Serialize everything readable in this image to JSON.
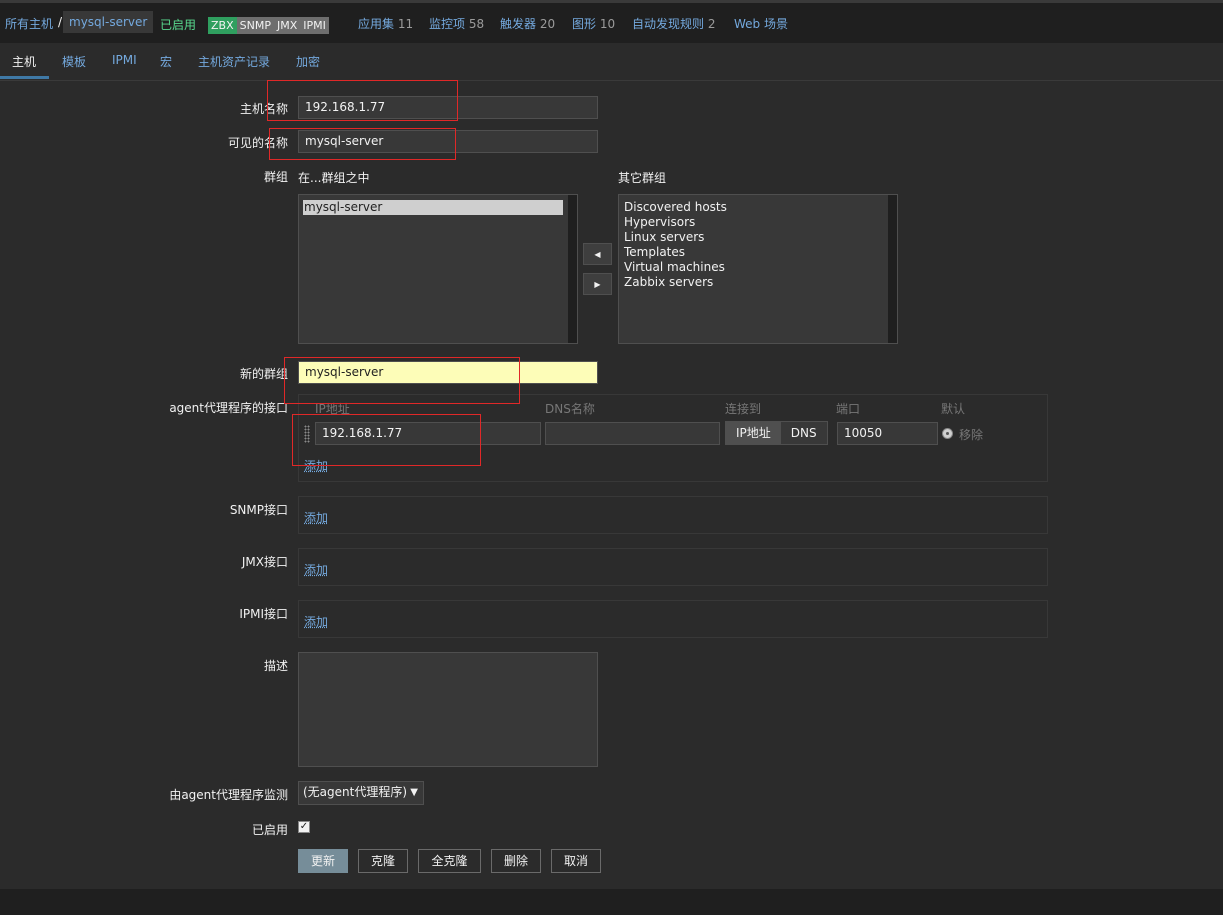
{
  "header": {
    "crumb_all_hosts": "所有主机",
    "crumb_sep": "/",
    "crumb_host": "mysql-server",
    "status": "已启用",
    "badges": [
      "ZBX",
      "SNMP",
      "JMX",
      "IPMI"
    ],
    "links": [
      {
        "label": "应用集",
        "count": "11"
      },
      {
        "label": "监控项",
        "count": "58"
      },
      {
        "label": "触发器",
        "count": "20"
      },
      {
        "label": "图形",
        "count": "10"
      },
      {
        "label": "自动发现规则",
        "count": "2"
      },
      {
        "label": "Web 场景",
        "count": ""
      }
    ]
  },
  "tabs": [
    "主机",
    "模板",
    "IPMI",
    "宏",
    "主机资产记录",
    "加密"
  ],
  "form": {
    "hostname_label": "主机名称",
    "hostname_value": "192.168.1.77",
    "visible_name_label": "可见的名称",
    "visible_name_value": "mysql-server",
    "groups_label": "群组",
    "in_groups_label": "在...群组之中",
    "other_groups_label": "其它群组",
    "in_groups": [
      "mysql-server"
    ],
    "other_groups": [
      "Discovered hosts",
      "Hypervisors",
      "Linux servers",
      "Templates",
      "Virtual machines",
      "Zabbix servers"
    ],
    "new_group_label": "新的群组",
    "new_group_value": "mysql-server",
    "agent_iface_label": "agent代理程序的接口",
    "iface_headers": {
      "ip": "IP地址",
      "dns": "DNS名称",
      "connect": "连接到",
      "port": "端口",
      "default": "默认"
    },
    "iface_ip": "192.168.1.77",
    "iface_dns": "",
    "connect_ip": "IP地址",
    "connect_dns": "DNS",
    "iface_port": "10050",
    "remove_label": "移除",
    "add_label": "添加",
    "snmp_label": "SNMP接口",
    "jmx_label": "JMX接口",
    "ipmi_label": "IPMI接口",
    "description_label": "描述",
    "proxy_label": "由agent代理程序监测",
    "proxy_value": "(无agent代理程序)",
    "enabled_label": "已启用",
    "enabled_checked": true
  },
  "buttons": {
    "update": "更新",
    "clone": "克隆",
    "full_clone": "全克隆",
    "delete": "删除",
    "cancel": "取消"
  },
  "colors": {
    "accent_link": "#74a9de",
    "highlight_input": "#fdfdb8",
    "annotation_red": "#e02828",
    "zbx_green": "#2f9f5f"
  }
}
